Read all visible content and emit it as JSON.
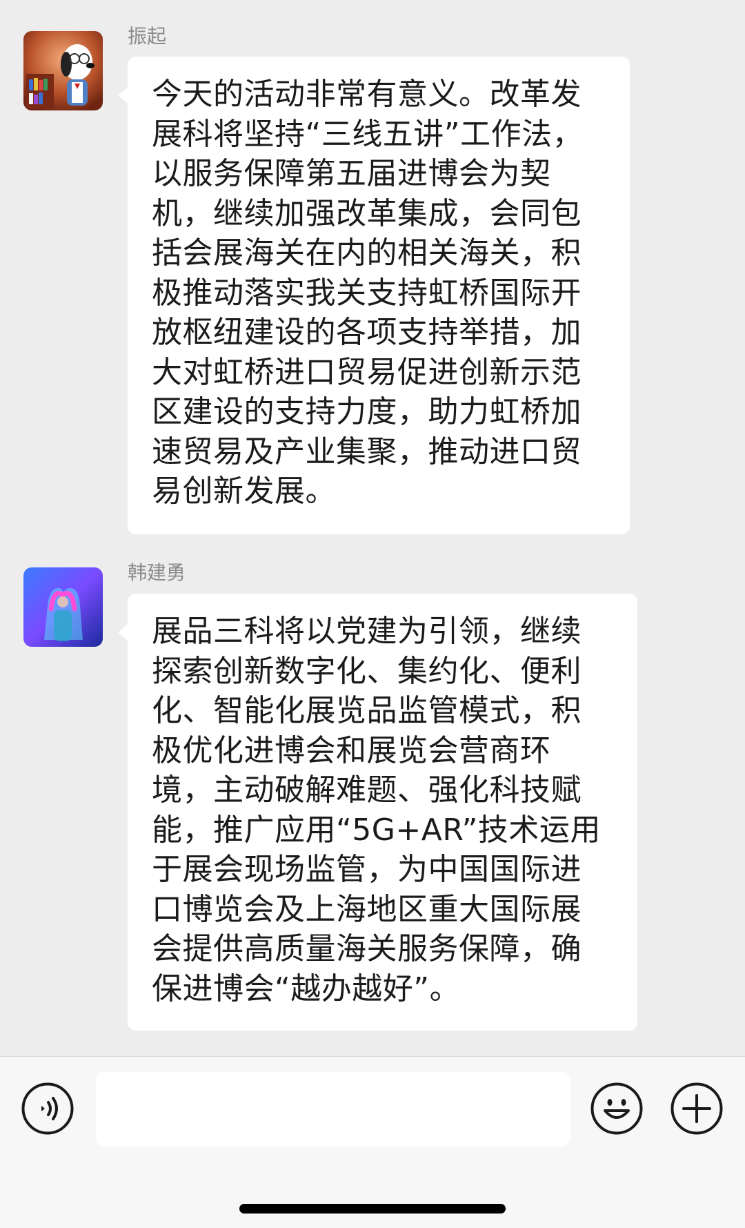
{
  "messages": [
    {
      "sender": "振起",
      "avatar": "snoopy-avatar",
      "lines": [
        "今天的活动非常有意义。改革发",
        "展科将坚持“三线五讲”工作法，",
        "以服务保障第五届进博会为契",
        "机，继续加强改革集成，会同包",
        "括会展海关在内的相关海关，积",
        "极推动落实我关支持虹桥国际开",
        "放枢纽建设的各项支持举措，加",
        "大对虹桥进口贸易促进创新示范",
        "区建设的支持力度，助力虹桥加",
        "速贸易及产业集聚，推动进口贸",
        "易创新发展。"
      ]
    },
    {
      "sender": "韩建勇",
      "avatar": "heart-hands-avatar",
      "lines": [
        "展品三科将以党建为引领，继续",
        "探索创新数字化、集约化、便利",
        "化、智能化展览品监管模式，积",
        "极优化进博会和展览会营商环",
        "境，主动破解难题、强化科技赋",
        "能，推广应用“5G+AR”技术运用",
        "于展会现场监管，为中国国际进",
        "口博览会及上海地区重大国际展",
        "会提供高质量海关服务保障，确",
        "保进博会“越办越好”。"
      ]
    }
  ],
  "input_bar": {
    "placeholder": "",
    "voice_icon": "voice-icon",
    "emoji_icon": "emoji-icon",
    "plus_icon": "plus-icon"
  },
  "colors": {
    "chat_background": "#ededed",
    "bubble": "#ffffff",
    "sender_name": "#8a8a8a",
    "text": "#1b1b1b"
  }
}
